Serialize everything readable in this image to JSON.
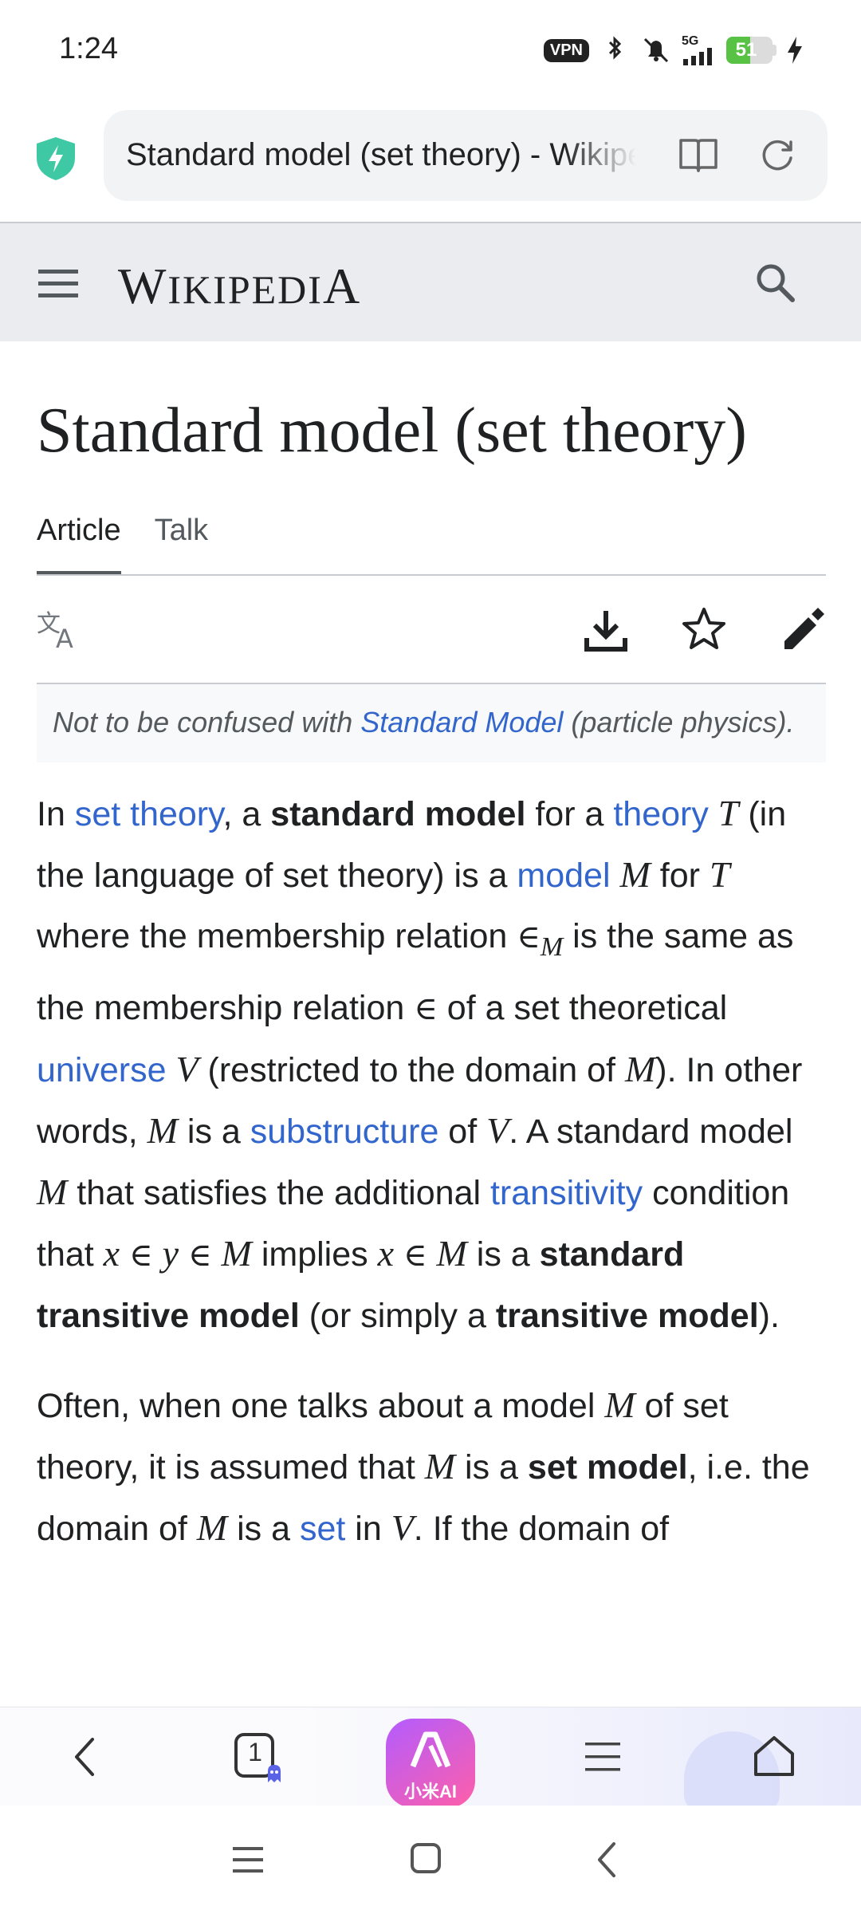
{
  "status_bar": {
    "time": "1:24",
    "vpn": "VPN",
    "network": "5G",
    "battery_percent": "51",
    "battery_level": 0.51,
    "battery_color": "#57c243"
  },
  "browser": {
    "url_title": "Standard model (set theory) - Wikipedia",
    "shield_color": "#3ec8a4"
  },
  "wiki": {
    "logo_first": "W",
    "logo_mid": "IKIPEDI",
    "logo_last": "A"
  },
  "article": {
    "title": "Standard model (set theory)",
    "tabs": [
      {
        "label": "Article",
        "active": true
      },
      {
        "label": "Talk",
        "active": false
      }
    ],
    "hatnote": {
      "pre": "Not to be confused with ",
      "link": "Standard Model",
      "post": " (particle physics)."
    },
    "p1": {
      "t1": "In ",
      "l_set_theory": "set theory",
      "t2": ", a ",
      "b_standard_model": "standard model",
      "t3": " for a ",
      "l_theory": "theory",
      "m_T": "T",
      "t4": " (in the language of set theory) is a ",
      "l_model": "model",
      "m_M1": "M",
      "t5": " for ",
      "m_T2": "T",
      "t6": " where the membership relation ",
      "s_in": "∈",
      "m_sub": "M",
      "t7": " is the same as the membership relation ",
      "s_in2": "∈",
      "t8": " of a set theoretical ",
      "l_universe": "universe",
      "m_V": "V",
      "t9": " (restricted to the domain of ",
      "m_M2": "M",
      "t10": "). In other words, ",
      "m_M3": "M",
      "t11": " is a ",
      "l_substructure": "substructure",
      "t12": " of ",
      "m_V2": "V",
      "t13": ". A standard model ",
      "m_M4": "M",
      "t14": " that satisfies the additional ",
      "l_transitivity": "transitivity",
      "t15": " condition that ",
      "m_x": "x",
      "s_in3": "∈",
      "m_y": "y",
      "s_in4": "∈",
      "m_M5": "M",
      "t16": " implies ",
      "m_x2": "x",
      "s_in5": "∈",
      "m_M6": "M",
      "t17": " is a ",
      "b_stm": "standard transitive model",
      "t18": " (or simply a ",
      "b_tm": "transitive model",
      "t19": ")."
    },
    "p2": {
      "t1": "Often, when one talks about a model ",
      "m_M1": "M",
      "t2": " of set theory, it is assumed that ",
      "m_M2": "M",
      "t3": " is a ",
      "b_set_model": "set model",
      "t4": ", i.e. the domain of ",
      "m_M3": "M",
      "t5": " is a ",
      "l_set": "set",
      "t6": " in ",
      "m_V": "V",
      "t7": ". If the domain of"
    }
  },
  "bottom_bar": {
    "tab_count": "1",
    "ai_label": "小米AI",
    "ai_colors": [
      "#b35cff",
      "#ff5fa8"
    ]
  },
  "icons": [
    "shield-icon",
    "reader-mode-icon",
    "reload-icon",
    "menu-icon",
    "search-icon",
    "translate-icon",
    "download-icon",
    "star-icon",
    "edit-icon",
    "back-icon",
    "tabs-icon",
    "ai-icon",
    "menu-lines-icon",
    "home-icon"
  ]
}
